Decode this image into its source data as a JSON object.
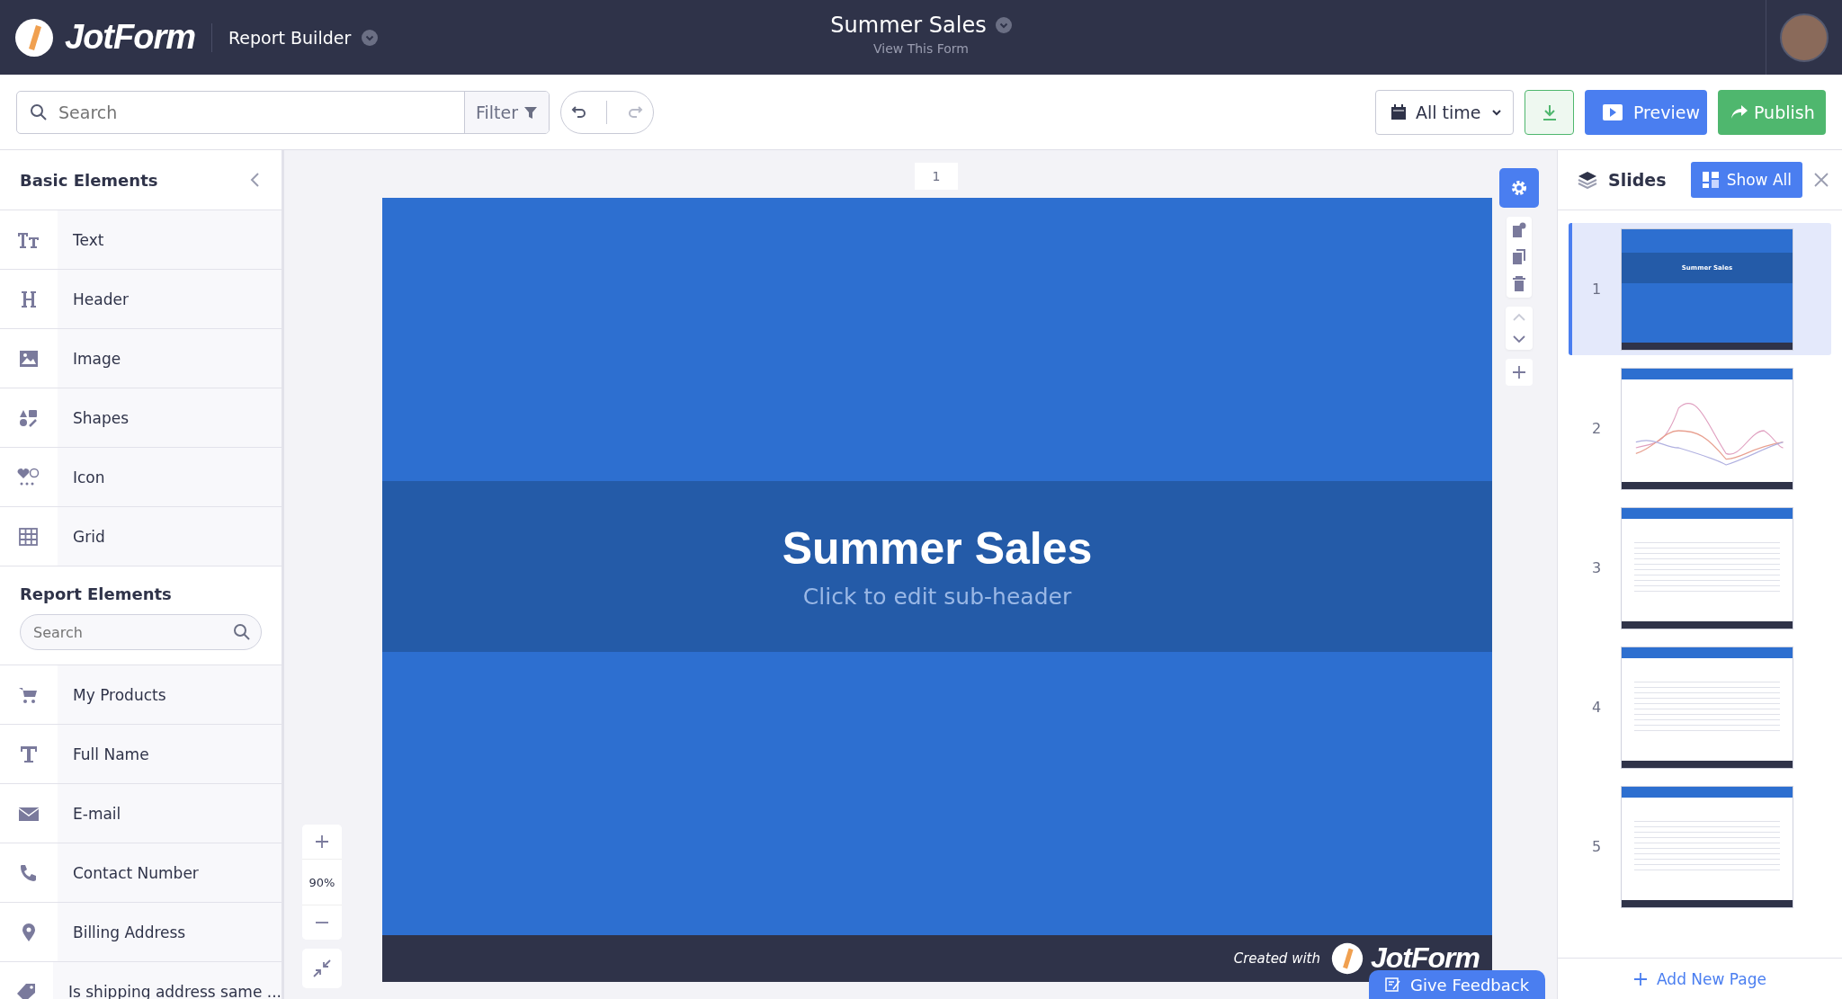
{
  "header": {
    "brand": "JotForm",
    "app": "Report Builder",
    "title": "Summer Sales",
    "subtitle": "View This Form"
  },
  "toolbar": {
    "search": {
      "placeholder": "Search"
    },
    "filter": "Filter",
    "date_range": "All time",
    "preview": "Preview",
    "publish": "Publish"
  },
  "basic_elements": {
    "title": "Basic Elements",
    "items": [
      "Text",
      "Header",
      "Image",
      "Shapes",
      "Icon",
      "Grid"
    ]
  },
  "report_elements": {
    "title": "Report Elements",
    "search": {
      "placeholder": "Search"
    },
    "items": [
      "My Products",
      "Full Name",
      "E-mail",
      "Contact Number",
      "Billing Address",
      "Is shipping address same ..."
    ]
  },
  "canvas": {
    "page_number": "1",
    "slide": {
      "title": "Summer Sales",
      "subheader": "Click to edit sub-header",
      "footer_text": "Created with",
      "footer_brand": "JotForm"
    },
    "zoom": "90%",
    "feedback": "Give Feedback"
  },
  "slides_panel": {
    "title": "Slides",
    "show_all": "Show All",
    "add_page": "Add New Page",
    "slides": [
      {
        "number": "1",
        "kind": "cover",
        "title": "Summer Sales",
        "selected": true
      },
      {
        "number": "2",
        "kind": "chart",
        "selected": false
      },
      {
        "number": "3",
        "kind": "table",
        "selected": false
      },
      {
        "number": "4",
        "kind": "table",
        "selected": false
      },
      {
        "number": "5",
        "kind": "table",
        "selected": false
      }
    ]
  }
}
